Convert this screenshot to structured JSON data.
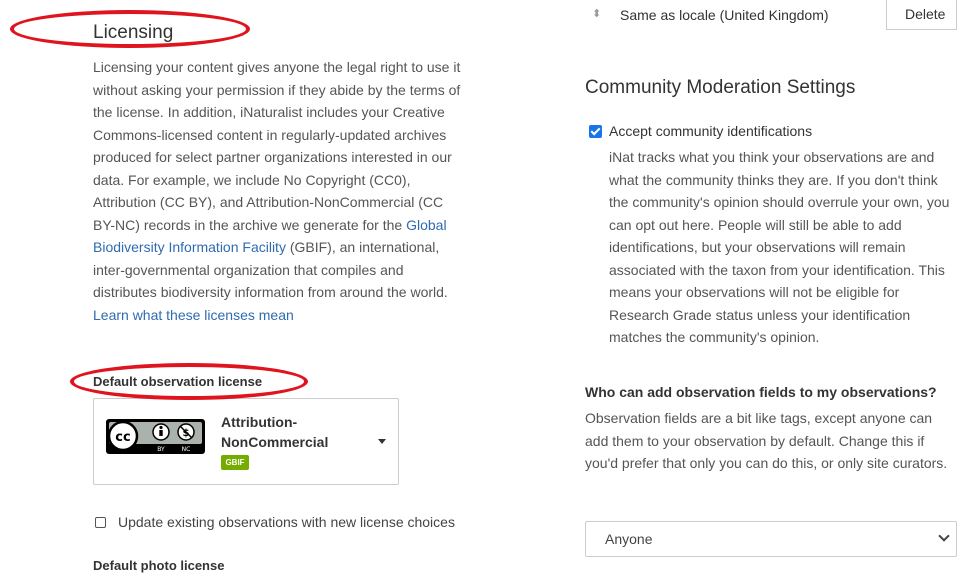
{
  "licensing": {
    "title": "Licensing",
    "paragraph_part1": "Licensing your content gives anyone the legal right to use it without asking your permission if they abide by the terms of the license. In addition, iNaturalist includes your Creative Commons-licensed content in regularly-updated archives produced for select partner organizations interested in our data. For example, we include No Copyright (CC0), Attribution (CC BY), and Attribution-NonCommercial (CC BY-NC) records in the archive we generate for the ",
    "gbif_link": "Global Biodiversity Information Facility",
    "paragraph_part2": " (GBIF), an international, inter-governmental organization that compiles and distributes biodiversity information from around the world. ",
    "learn_link": "Learn what these licenses mean",
    "default_observation_license_label": "Default observation license",
    "selected_license": {
      "line1": "Attribution-",
      "line2": "NonCommercial",
      "badge": "GBIF",
      "logo_text": [
        "BY",
        "NC"
      ]
    },
    "update_existing_label": "Update existing observations with new license choices",
    "update_existing_checked": false,
    "default_photo_license_label": "Default photo license"
  },
  "locale": {
    "value": "Same as locale (United Kingdom)",
    "delete_label": "Delete"
  },
  "moderation": {
    "title": "Community Moderation Settings",
    "accept_label": "Accept community identifications",
    "accept_checked": true,
    "accept_desc": "iNat tracks what you think your observations are and what the community thinks they are. If you don't think the community's opinion should overrule your own, you can opt out here. People will still be able to add identifications, but your observations will remain associated with the taxon from your identification. This means your observations will not be eligible for Research Grade status unless your identification matches the community's opinion.",
    "fields_question": "Who can add observation fields to my observations?",
    "fields_desc": "Observation fields are a bit like tags, except anyone can add them to your observation by default. Change this if you'd prefer that only you can do this, or only site curators.",
    "fields_value": "Anyone"
  },
  "colors": {
    "annotation": "#e0141e",
    "link": "#2f6bb0",
    "gbif_badge": "#74ac00",
    "checkbox": "#1a73e8"
  }
}
